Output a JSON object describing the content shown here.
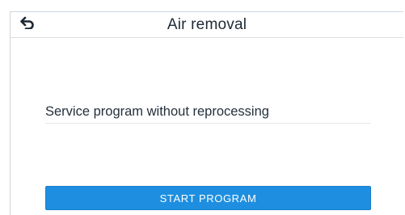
{
  "header": {
    "title": "Air removal",
    "back_icon": "back-arrow-icon"
  },
  "main": {
    "description": "Service program without reprocessing",
    "start_button_label": "START PROGRAM"
  },
  "colors": {
    "accent": "#1e8fe0",
    "text": "#1f2a35",
    "divider": "#d9dfe4"
  }
}
